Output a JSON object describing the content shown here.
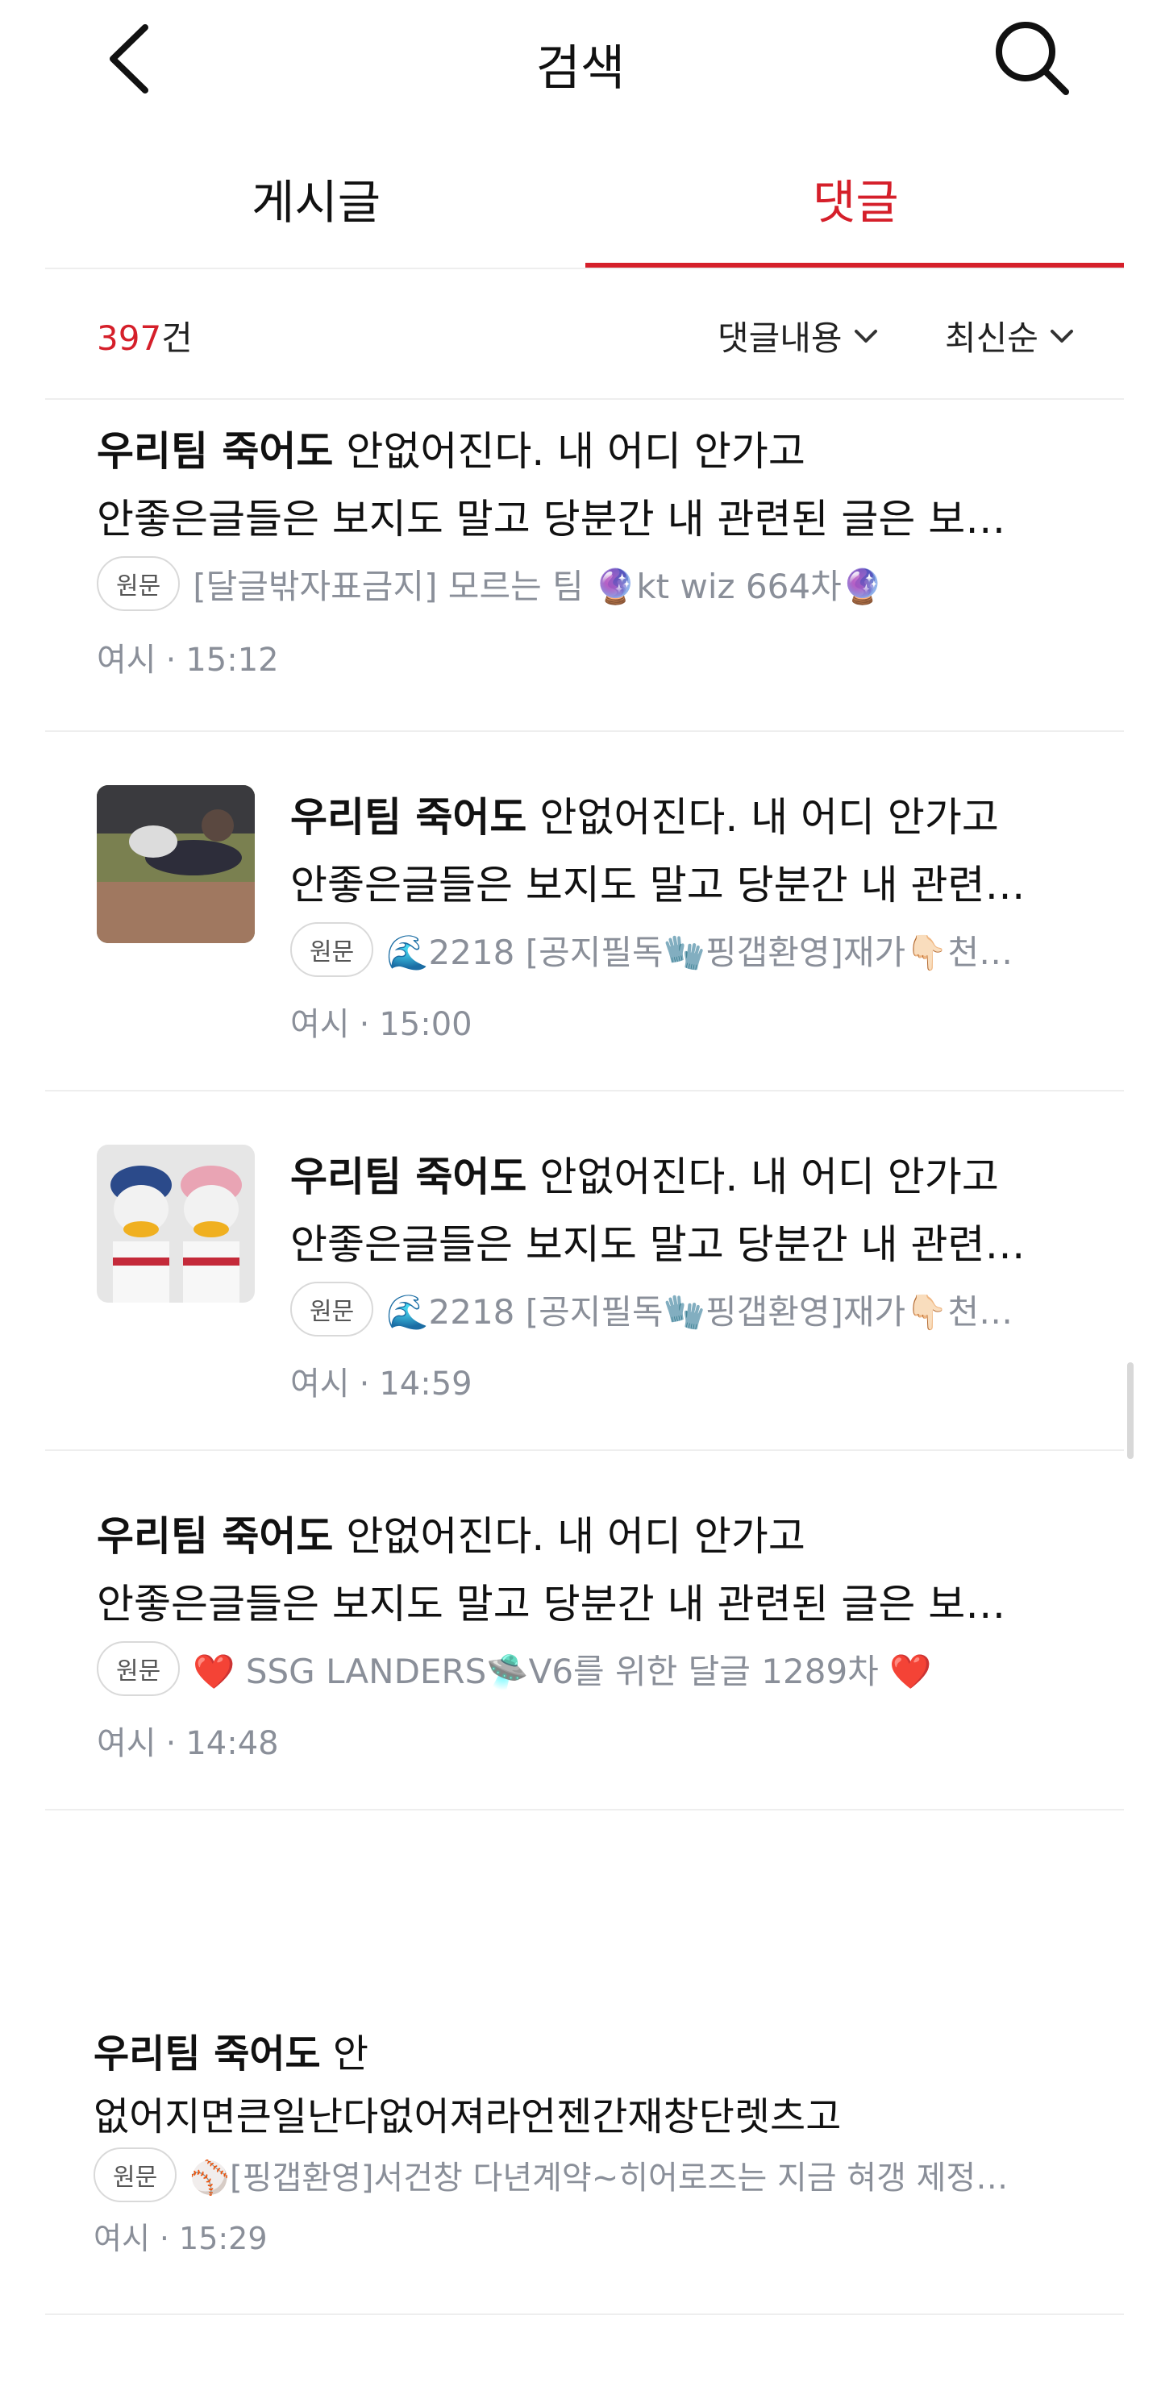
{
  "header": {
    "title": "검색"
  },
  "tabs": [
    {
      "label": "게시글"
    },
    {
      "label": "댓글"
    }
  ],
  "results_bar": {
    "count": "397",
    "count_suffix": "건",
    "filter_content": "댓글내용",
    "sort": "최신순"
  },
  "items": [
    {
      "bold": "우리팀 죽어도",
      "rest": " 안없어진다. 내 어디 안가고",
      "line2": "안좋은글들은 보지도 말고 당분간 내 관련된 글은 보…",
      "badge": "원문",
      "meta": "[달글밖자표금지] 모르는 팀 🔮kt wiz 664차🔮",
      "author": "여시",
      "time": "15:12"
    },
    {
      "bold": "우리팀 죽어도",
      "rest": " 안없어진다. 내 어디 안가고",
      "line2": "안좋은글들은 보지도 말고 당분간 내 관련…",
      "badge": "원문",
      "meta": "🌊2218 [공지필독🧤핑갭환영]재가👇🏻천…",
      "author": "여시",
      "time": "15:00"
    },
    {
      "bold": "우리팀 죽어도",
      "rest": " 안없어진다. 내 어디 안가고",
      "line2": "안좋은글들은 보지도 말고 당분간 내 관련…",
      "badge": "원문",
      "meta": "🌊2218 [공지필독🧤핑갭환영]재가👇🏻천…",
      "author": "여시",
      "time": "14:59"
    },
    {
      "bold": "우리팀 죽어도",
      "rest": " 안없어진다. 내 어디 안가고",
      "line2": "안좋은글들은 보지도 말고 당분간 내 관련된 글은 보…",
      "badge": "원문",
      "meta": "❤️ SSG LANDERS🛸V6를 위한 달글 1289차 ❤️",
      "author": "여시",
      "time": "14:48"
    },
    {
      "bold": "우리팀 죽어도",
      "rest": " 안",
      "line2": "없어지면큰일난다없어져라언젠간재창단렛츠고",
      "badge": "원문",
      "meta": "⚾[핑갭환영]서건창 다년계약~히어로즈는 지금 혀갱 제정…",
      "author": "여시",
      "time": "15:29"
    }
  ],
  "icons": {
    "back": "back-chevron-icon",
    "search": "search-icon",
    "dropdown": "chevron-down-icon"
  },
  "colors": {
    "accent": "#d51f2a",
    "muted": "#8a8f99"
  }
}
